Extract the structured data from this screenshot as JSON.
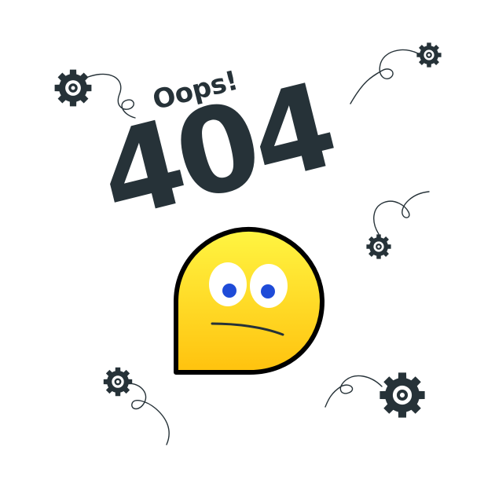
{
  "headline": {
    "exclamation": "Oops!",
    "error_code": "404"
  },
  "colors": {
    "text": "#263238",
    "gear": "#263238",
    "gear_hole": "#ffffff",
    "wire": "#263238",
    "face_top": "#fff542",
    "face_bottom": "#ffc20e",
    "face_outline": "#000000",
    "eye_white": "#ffffff",
    "pupil": "#1e4bd8",
    "mouth": "#263238"
  },
  "icons": [
    "gear-icon",
    "confused-face-icon"
  ]
}
